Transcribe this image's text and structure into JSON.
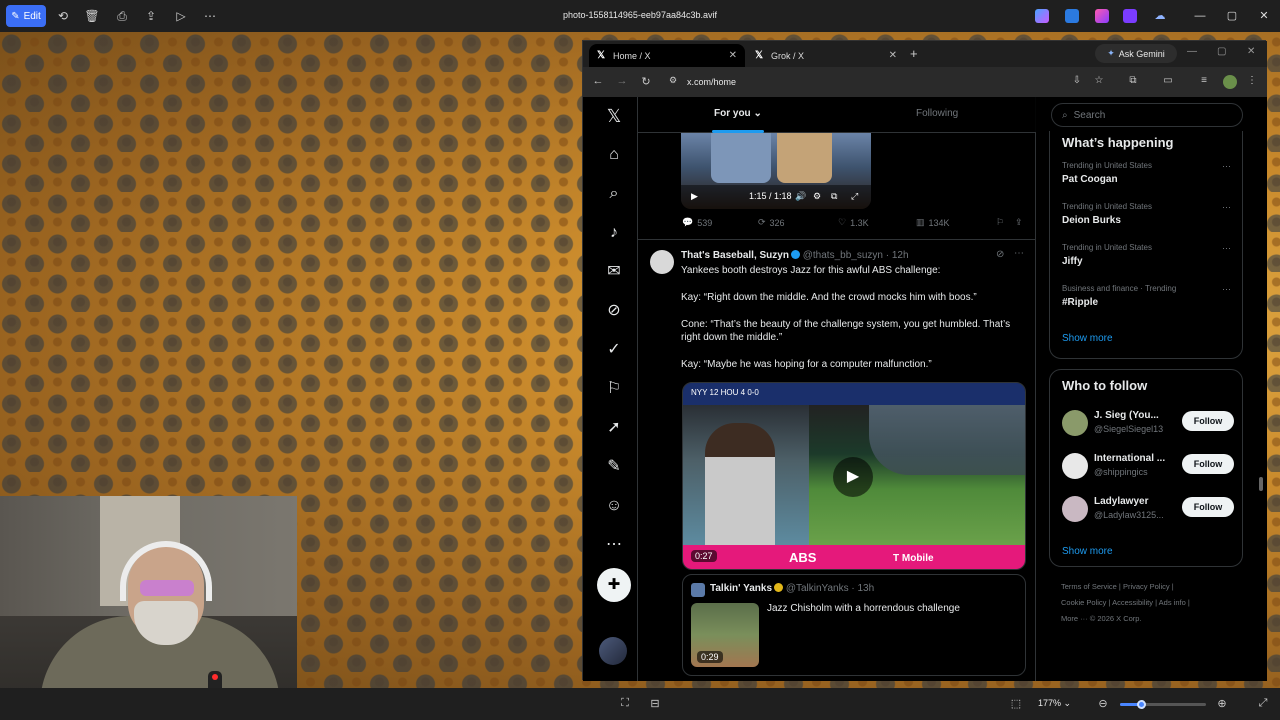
{
  "viewer": {
    "edit_label": "Edit",
    "file_title": "photo-1558114965-eeb97aa84c3b.avif",
    "zoom_level": "177%",
    "zoom_fraction": 0.25
  },
  "browser": {
    "tabs": [
      {
        "label": "Home / X",
        "active": true
      },
      {
        "label": "Grok / X",
        "active": false
      }
    ],
    "new_tab": "+",
    "ask_gemini": "Ask Gemini",
    "url": "x.com/home"
  },
  "feed": {
    "tabs": [
      "For you",
      "Following"
    ],
    "video1": {
      "time": "1:15 / 1:18"
    },
    "tweet1_actions": {
      "replies": "539",
      "reposts": "326",
      "likes": "1.3K",
      "views": "134K"
    },
    "tweet2": {
      "author": "That's Baseball, Suzyn",
      "handle": "@thats_bb_suzyn",
      "time": "· 12h",
      "lines": [
        "Yankees booth destroys Jazz for this awful ABS challenge:",
        "Kay: “Right down the middle. And the crowd mocks him with boos.”",
        "Cone: “That’s the beauty of the challenge system, you get humbled. That’s right down the middle.”",
        "Kay: “Maybe he was hoping for a computer malfunction.”"
      ],
      "video": {
        "scorebug": "NYY 12  HOU 4  0-0",
        "abs_label": "ABS",
        "sponsor": "T Mobile",
        "duration": "0:27"
      },
      "quote": {
        "author": "Talkin' Yanks",
        "handle": "@TalkinYanks · 13h",
        "text": "Jazz Chisholm with a horrendous challenge",
        "duration": "0:29"
      }
    }
  },
  "sidebar": {
    "search_placeholder": "Search",
    "happening_title": "What’s happening",
    "trends": [
      {
        "context": "Trending in United States",
        "name": "Pat Coogan"
      },
      {
        "context": "Trending in United States",
        "name": "Deion Burks"
      },
      {
        "context": "Trending in United States",
        "name": "Jiffy"
      },
      {
        "context": "Business and finance · Trending",
        "name": "#Ripple"
      }
    ],
    "show_more": "Show more",
    "wtf_title": "Who to follow",
    "follow_label": "Follow",
    "suggestions": [
      {
        "name": "J. Sieg (You...",
        "handle": "@SiegelSiegel13",
        "color": "#8a9a6a"
      },
      {
        "name": "International ...",
        "handle": "@shippingics",
        "color": "#e8e8e8"
      },
      {
        "name": "Ladylawyer",
        "handle": "@Ladylaw3125...",
        "color": "#c9b8c2"
      }
    ],
    "footer": {
      "line1": "Terms of Service  |  Privacy Policy  |",
      "line2": "Cookie Policy  |  Accessibility  |  Ads info  |",
      "line3": "More ···   © 2026 X Corp."
    }
  },
  "colors": {
    "accent": "#1d9bf0",
    "abs_banner": "#e5197b",
    "viewer_accent": "#3b6ef5"
  }
}
